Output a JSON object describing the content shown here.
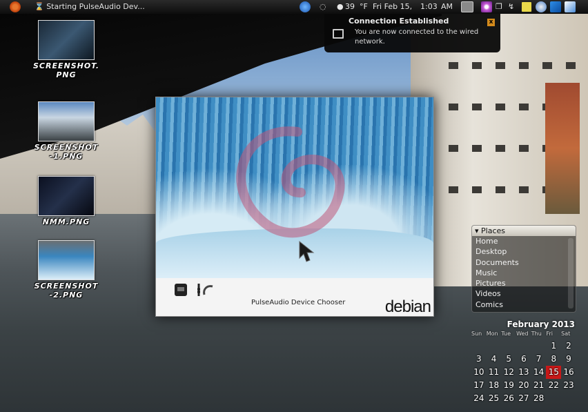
{
  "panel": {
    "task_label": "Starting PulseAudio Dev...",
    "tray": {
      "volume_value": "39",
      "temp_unit": "°F",
      "date": "Fri Feb 15,",
      "time": "1:03",
      "ampm": "AM"
    }
  },
  "desktop_icons": [
    {
      "label": "SCREENSHOT.\nPNG"
    },
    {
      "label": "SCREENSHOT\n-1.PNG"
    },
    {
      "label": "NMM.PNG"
    },
    {
      "label": "SCREENSHOT\n-2.PNG"
    }
  ],
  "notification": {
    "title": "Connection Established",
    "body": "You are now connected to the wired network.",
    "close": "x"
  },
  "chooser": {
    "caption": "PulseAudio Device Chooser",
    "brand": "debian"
  },
  "places": {
    "header": "▾ Places",
    "items": [
      "Home",
      "Desktop",
      "Documents",
      "Music",
      "Pictures",
      "Videos",
      "Comics"
    ]
  },
  "calendar": {
    "month": "February 2013",
    "weekdays": [
      "Sun",
      "Mon",
      "Tue",
      "Wed",
      "Thu",
      "Fri",
      "Sat"
    ],
    "days": [
      "",
      "",
      "",
      "",
      "",
      "1",
      "2",
      "3",
      "4",
      "5",
      "6",
      "7",
      "8",
      "9",
      "10",
      "11",
      "12",
      "13",
      "14",
      "15",
      "16",
      "17",
      "18",
      "19",
      "20",
      "21",
      "22",
      "23",
      "24",
      "25",
      "26",
      "27",
      "28",
      "",
      ""
    ],
    "today": "15",
    "today_color": "#c81818"
  },
  "colors": {
    "panel": "#111111",
    "notification_accent": "#d38a1c"
  }
}
